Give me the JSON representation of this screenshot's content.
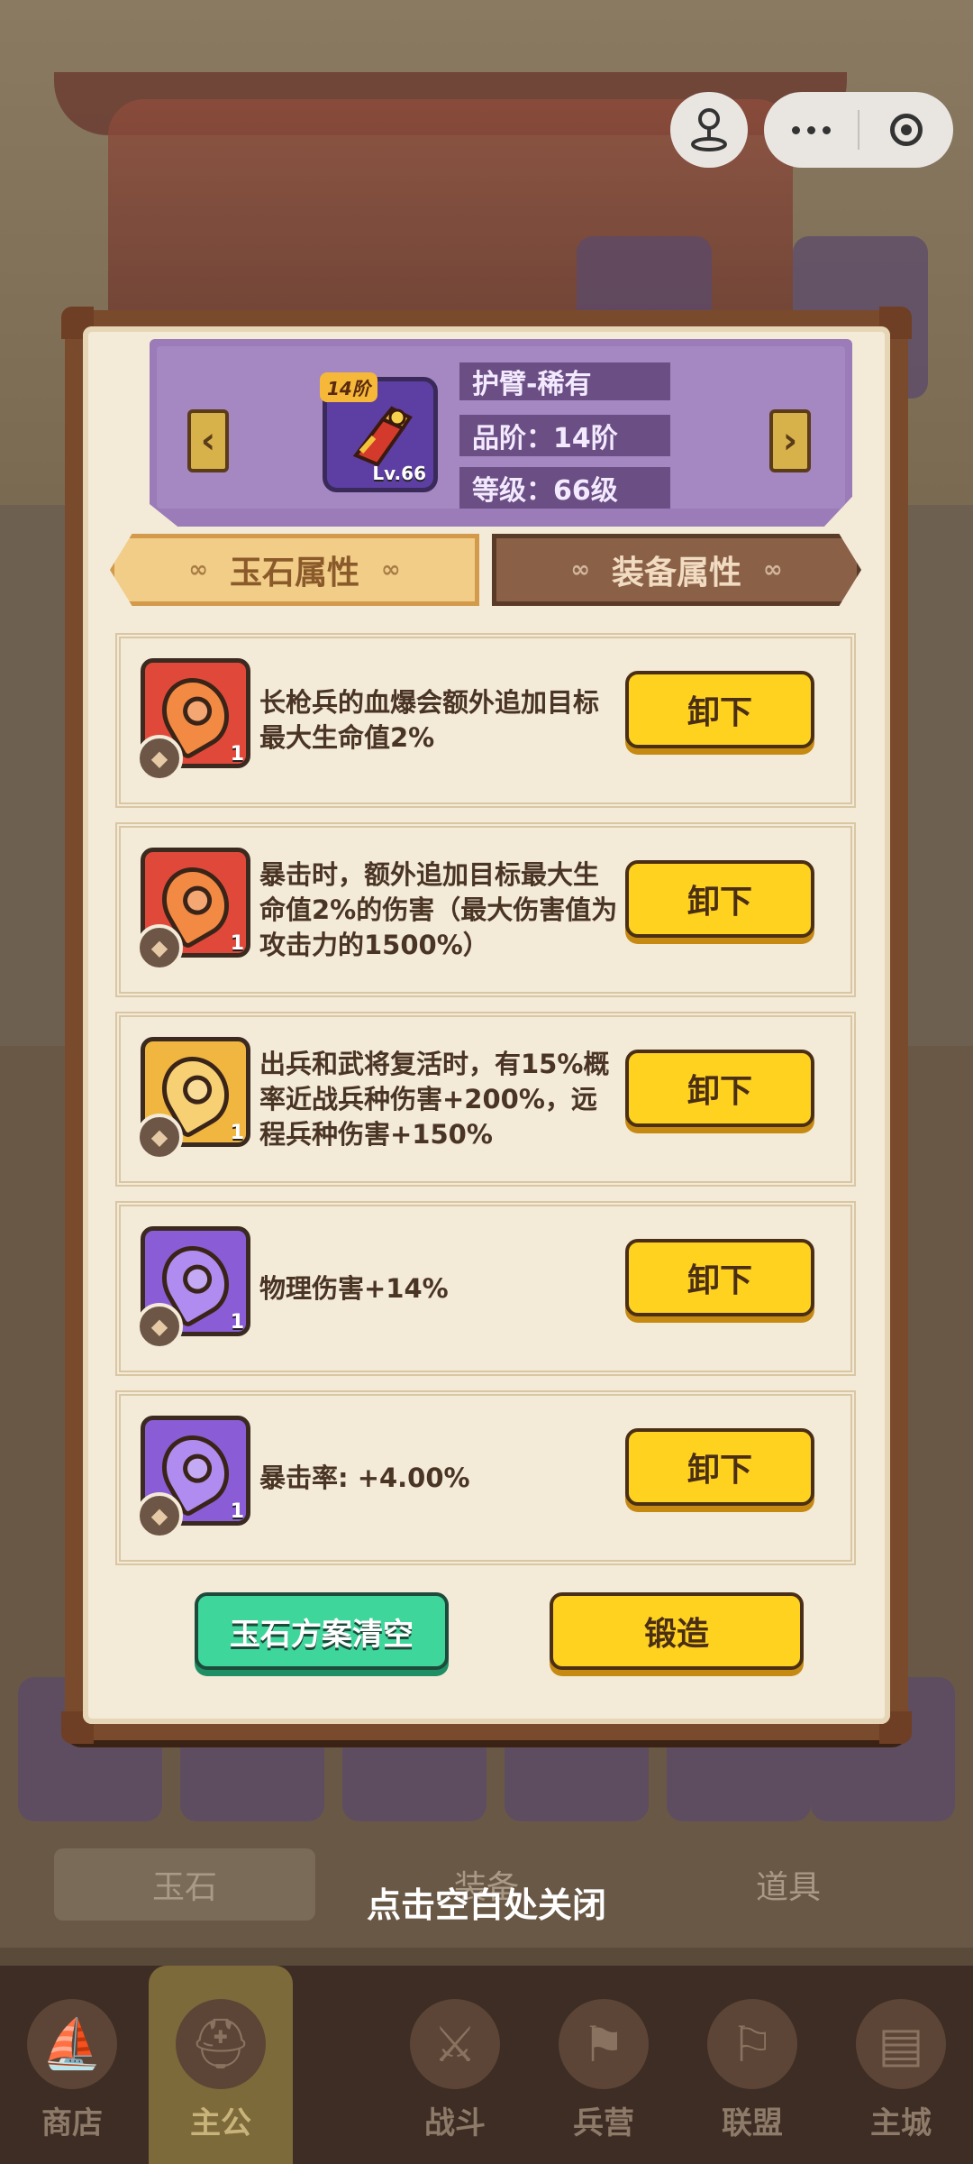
{
  "capsule": {
    "more_icon": "more-dots-icon",
    "close_icon": "target-close-icon",
    "profile_icon": "joystick-icon"
  },
  "hero": {
    "item_name": "护臂-稀有",
    "tier_label": "品阶：14阶",
    "level_label": "等级：66级",
    "tier_badge": "14阶",
    "item_level": "Lv.66",
    "prev_icon": "chevron-left-icon",
    "next_icon": "chevron-right-icon",
    "item_color": "#5d3ea2"
  },
  "tabs": [
    {
      "label": "玉石属性",
      "active": true
    },
    {
      "label": "装备属性",
      "active": false
    }
  ],
  "gems": [
    {
      "text": "长枪兵的血爆会额外追加目标最大生命值2%",
      "count": "1",
      "rarity_color": "#e0493a",
      "button": "卸下"
    },
    {
      "text": "暴击时，额外追加目标最大生命值2%的伤害（最大伤害值为攻击力的1500%）",
      "count": "1",
      "rarity_color": "#e0493a",
      "button": "卸下"
    },
    {
      "text": "出兵和武将复活时，有15%概率近战兵种伤害+200%，远程兵种伤害+150%",
      "count": "1",
      "rarity_color": "#f0b640",
      "button": "卸下"
    },
    {
      "text": "物理伤害+14%",
      "count": "1",
      "rarity_color": "#8a5cd6",
      "button": "卸下"
    },
    {
      "text": "暴击率: +4.00%",
      "count": "1",
      "rarity_color": "#8a5cd6",
      "button": "卸下"
    }
  ],
  "actions": {
    "clear": "玉石方案清空",
    "forge": "锻造"
  },
  "close_hint": "点击空白处关闭",
  "background": {
    "tabs": [
      "玉石",
      "装备",
      "道具"
    ],
    "nav": [
      {
        "label": "商店",
        "icon": "boat-icon"
      },
      {
        "label": "主公",
        "icon": "helmet-icon"
      },
      {
        "label": "战斗",
        "icon": "swords-icon"
      },
      {
        "label": "兵营",
        "icon": "flag-icon"
      },
      {
        "label": "联盟",
        "icon": "banner-icon"
      },
      {
        "label": "主城",
        "icon": "map-icon"
      }
    ]
  }
}
